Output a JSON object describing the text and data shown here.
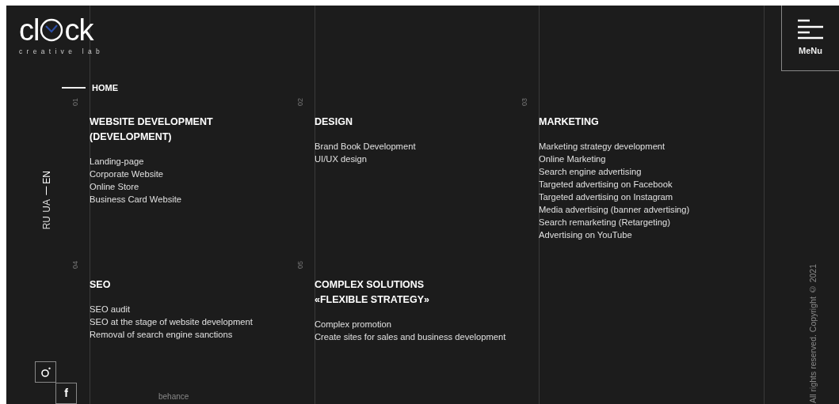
{
  "logo": {
    "wordmark_start": "cl",
    "wordmark_end": "ck",
    "tagline": "creative lab"
  },
  "menu_button": {
    "label": "MeNu"
  },
  "breadcrumb": {
    "label": "HOME"
  },
  "languages": [
    {
      "label": "RU",
      "selected": false
    },
    {
      "label": "UA",
      "selected": false
    },
    {
      "label": "EN",
      "selected": true
    }
  ],
  "services": [
    {
      "number": "01",
      "title": "WEBSITE DEVELOPMENT (DEVELOPMENT)",
      "items": [
        "Landing-page",
        "Corporate Website",
        "Online Store",
        "Business Card Website"
      ]
    },
    {
      "number": "02",
      "title": "DESIGN",
      "items": [
        "Brand Book Development",
        "UI/UX design"
      ]
    },
    {
      "number": "03",
      "title": "MARKETING",
      "items": [
        "Marketing strategy development",
        "Online Marketing",
        "Search engine advertising",
        "Targeted advertising on Facebook",
        "Targeted advertising on Instagram",
        "Media advertising (banner advertising)",
        "Search remarketing (Retargeting)",
        "Advertising on YouTube"
      ]
    },
    {
      "number": "04",
      "title": "SEO",
      "items": [
        "SEO audit",
        "SEO at the stage of website development",
        "Removal of search engine sanctions"
      ]
    },
    {
      "number": "05",
      "title": "COMPLEX SOLUTIONS «FLEXIBLE STRATEGY»",
      "items": [
        "Complex promotion",
        "Create sites for sales and business development"
      ]
    }
  ],
  "social_links": [
    {
      "kind": "camera"
    },
    {
      "kind": "glyph",
      "label": "f"
    }
  ],
  "footer_link": "behance",
  "copyright": "All rights reserved. Copyright © 2021"
}
